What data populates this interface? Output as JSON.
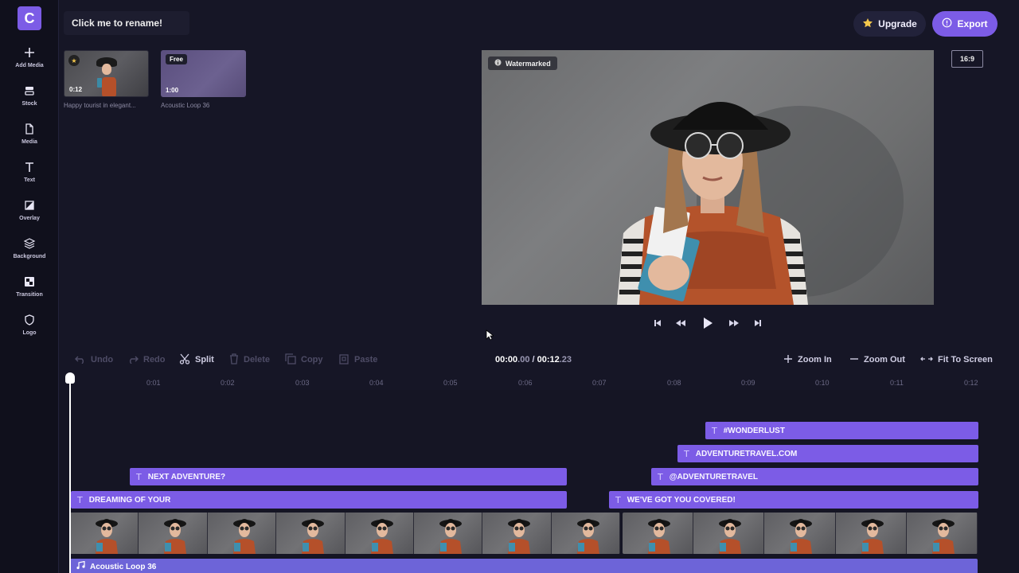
{
  "app": {
    "logo_letter": "C",
    "brand_color": "#7c5ce6"
  },
  "sidebar": {
    "items": [
      {
        "label": "Add Media",
        "icon": "plus-icon"
      },
      {
        "label": "Stock",
        "icon": "stock-icon"
      },
      {
        "label": "Media",
        "icon": "file-icon"
      },
      {
        "label": "Text",
        "icon": "text-icon"
      },
      {
        "label": "Overlay",
        "icon": "overlay-icon"
      },
      {
        "label": "Background",
        "icon": "layers-icon"
      },
      {
        "label": "Transition",
        "icon": "transition-icon"
      },
      {
        "label": "Logo",
        "icon": "shield-icon"
      }
    ]
  },
  "header": {
    "project_name": "Click me to rename!",
    "upgrade_label": "Upgrade",
    "export_label": "Export"
  },
  "media": {
    "items": [
      {
        "title": "Happy tourist in elegant...",
        "duration": "0:12",
        "badge": "star"
      },
      {
        "title": "Acoustic Loop 36",
        "duration": "1:00",
        "badge": "Free"
      }
    ]
  },
  "preview": {
    "watermark_label": "Watermarked",
    "aspect_ratio": "16:9"
  },
  "toolbar": {
    "undo": "Undo",
    "redo": "Redo",
    "split": "Split",
    "delete": "Delete",
    "copy": "Copy",
    "paste": "Paste",
    "zoom_in": "Zoom In",
    "zoom_out": "Zoom Out",
    "fit": "Fit To Screen"
  },
  "timecode": {
    "current_main": "00:00",
    "current_frac": ".00",
    "separator": " / ",
    "total_main": "00:12",
    "total_frac": ".23"
  },
  "ruler": {
    "ticks": [
      "0:01",
      "0:02",
      "0:03",
      "0:04",
      "0:05",
      "0:06",
      "0:07",
      "0:08",
      "0:09",
      "0:10",
      "0:11",
      "0:12"
    ]
  },
  "timeline": {
    "text_clips": [
      {
        "label": "#WONDERLUST"
      },
      {
        "label": "ADVENTURETRAVEL.COM"
      },
      {
        "label": "NEXT ADVENTURE?"
      },
      {
        "label": "@ADVENTURETRAVEL"
      },
      {
        "label": "DREAMING OF YOUR"
      },
      {
        "label": "WE'VE GOT YOU COVERED!"
      }
    ],
    "audio_clip": "Acoustic Loop 36"
  }
}
